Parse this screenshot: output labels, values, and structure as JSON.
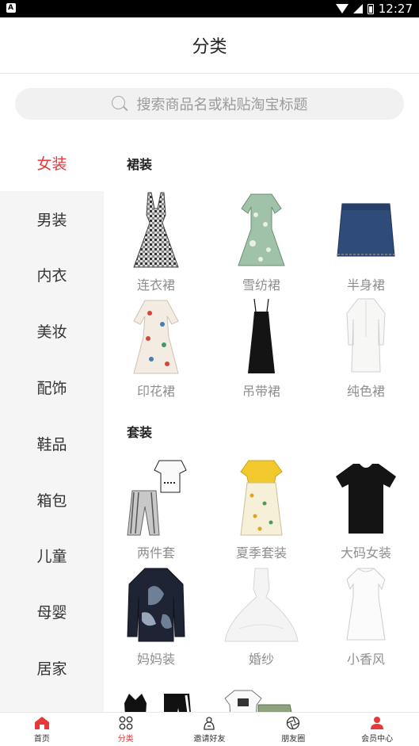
{
  "status_bar": {
    "time": "12:27",
    "left_badge": "A"
  },
  "header": {
    "title": "分类"
  },
  "search": {
    "placeholder": "搜索商品名或粘贴淘宝标题"
  },
  "sidebar": {
    "items": [
      {
        "label": "女装",
        "active": true
      },
      {
        "label": "男装"
      },
      {
        "label": "内衣"
      },
      {
        "label": "美妆"
      },
      {
        "label": "配饰"
      },
      {
        "label": "鞋品"
      },
      {
        "label": "箱包"
      },
      {
        "label": "儿童"
      },
      {
        "label": "母婴"
      },
      {
        "label": "居家"
      }
    ]
  },
  "sections": [
    {
      "title": "裙装",
      "items": [
        {
          "label": "连衣裙",
          "icon": "gingham-dress-icon"
        },
        {
          "label": "雪纺裙",
          "icon": "chiffon-dress-icon"
        },
        {
          "label": "半身裙",
          "icon": "denim-skirt-icon"
        },
        {
          "label": "印花裙",
          "icon": "print-dress-icon"
        },
        {
          "label": "吊带裙",
          "icon": "slip-dress-icon"
        },
        {
          "label": "纯色裙",
          "icon": "solid-dress-icon"
        }
      ]
    },
    {
      "title": "套装",
      "items": [
        {
          "label": "两件套",
          "icon": "two-piece-icon"
        },
        {
          "label": "夏季套装",
          "icon": "summer-set-icon"
        },
        {
          "label": "大码女装",
          "icon": "plus-size-tee-icon"
        },
        {
          "label": "妈妈装",
          "icon": "mom-blouse-icon"
        },
        {
          "label": "婚纱",
          "icon": "wedding-gown-icon"
        },
        {
          "label": "小香风",
          "icon": "white-dress-icon"
        }
      ]
    }
  ],
  "tabbar": {
    "items": [
      {
        "label": "首页",
        "icon": "home-icon"
      },
      {
        "label": "分类",
        "icon": "category-grid-icon",
        "active": true
      },
      {
        "label": "邀请好友",
        "icon": "invite-friends-icon"
      },
      {
        "label": "朋友圈",
        "icon": "moments-icon"
      },
      {
        "label": "会员中心",
        "icon": "member-center-icon"
      }
    ]
  },
  "colors": {
    "accent": "#e8393a",
    "sidebar_bg": "#f5f5f5",
    "search_bg": "#f1f1f1"
  }
}
